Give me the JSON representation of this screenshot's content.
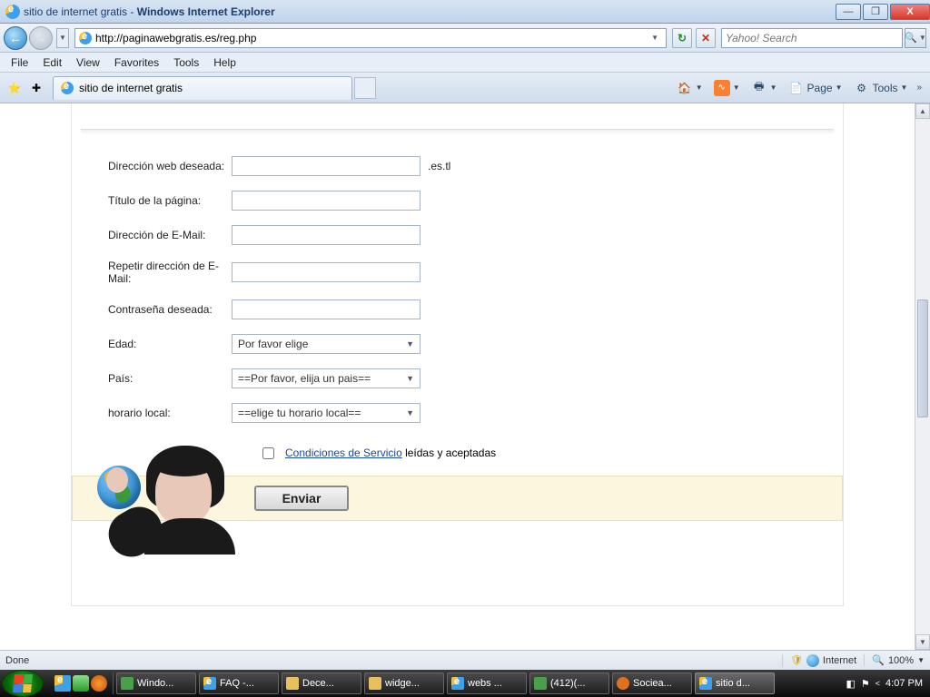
{
  "window": {
    "title_page": "sitio de internet gratis",
    "title_app": "Windows Internet Explorer",
    "url": "http://paginawebgratis.es/reg.php",
    "search_placeholder": "Yahoo! Search"
  },
  "menu": [
    "File",
    "Edit",
    "View",
    "Favorites",
    "Tools",
    "Help"
  ],
  "tab": {
    "label": "sitio de internet gratis"
  },
  "toolbar": {
    "page": "Page",
    "tools": "Tools"
  },
  "form": {
    "fields": {
      "direccion_web": {
        "label": "Dirección web deseada:",
        "value": "",
        "suffix": ".es.tl"
      },
      "titulo": {
        "label": "Título de la página:",
        "value": ""
      },
      "email": {
        "label": "Dirección de E-Mail:",
        "value": ""
      },
      "email2": {
        "label": "Repetir dirección de E-Mail:",
        "value": ""
      },
      "contrasena": {
        "label": "Contraseña deseada:",
        "value": ""
      },
      "edad": {
        "label": "Edad:",
        "selected": "Por favor elige"
      },
      "pais": {
        "label": "País:",
        "selected": "==Por favor, elija un pais=="
      },
      "horario": {
        "label": "horario local:",
        "selected": "==elige tu horario local=="
      }
    },
    "terms_link": "Condiciones de Servicio",
    "terms_rest": " leídas y aceptadas",
    "submit": "Enviar"
  },
  "status": {
    "left": "Done",
    "zone": "Internet",
    "zoom": "100%"
  },
  "taskbar": {
    "items": [
      "Windo...",
      "FAQ -...",
      "Dece...",
      "widge...",
      "webs ...",
      "(412)(...",
      "Sociea...",
      "sitio d..."
    ],
    "time": "4:07 PM"
  }
}
